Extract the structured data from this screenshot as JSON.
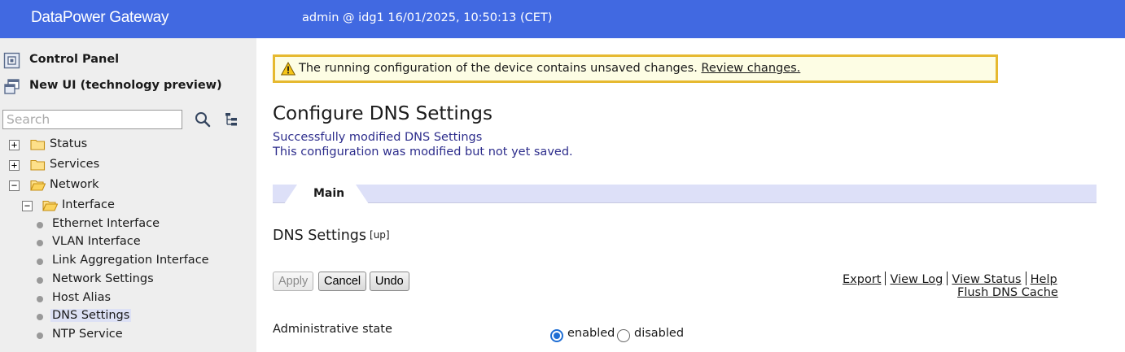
{
  "header": {
    "brand": "DataPower Gateway",
    "session": "admin @ idg1 16/01/2025, 10:50:13 (CET)"
  },
  "sidebar": {
    "control_panel": "Control Panel",
    "new_ui": "New UI (technology preview)",
    "search_placeholder": "Search",
    "tree": {
      "status": "Status",
      "services": "Services",
      "network": "Network",
      "interface": "Interface",
      "items": [
        "Ethernet Interface",
        "VLAN Interface",
        "Link Aggregation Interface",
        "Network Settings",
        "Host Alias",
        "DNS Settings",
        "NTP Service"
      ],
      "selected": "DNS Settings",
      "toggle_expand": "+",
      "toggle_collapse": "−"
    }
  },
  "main": {
    "warning_text": "The running configuration of the device contains unsaved changes.",
    "warning_link": "Review changes.",
    "page_title": "Configure DNS Settings",
    "message_1": "Successfully modified DNS Settings",
    "message_2": "This configuration was modified but not yet saved.",
    "tab_main": "Main",
    "section_title": "DNS Settings",
    "section_up": "[up]",
    "buttons": {
      "apply": "Apply",
      "cancel": "Cancel",
      "undo": "Undo"
    },
    "links": {
      "export": "Export",
      "view_log": "View Log",
      "view_status": "View Status",
      "help": "Help",
      "flush_dns_cache": "Flush DNS Cache"
    },
    "admin_state": {
      "label": "Administrative state",
      "enabled": "enabled",
      "disabled": "disabled",
      "value": "enabled"
    }
  },
  "colors": {
    "header_bg": "#4169e1",
    "warning_border": "#e6b930",
    "message_text": "#2d2d8c",
    "tab_bar": "#dde0f8",
    "radio_selected": "#1f6ed4"
  }
}
